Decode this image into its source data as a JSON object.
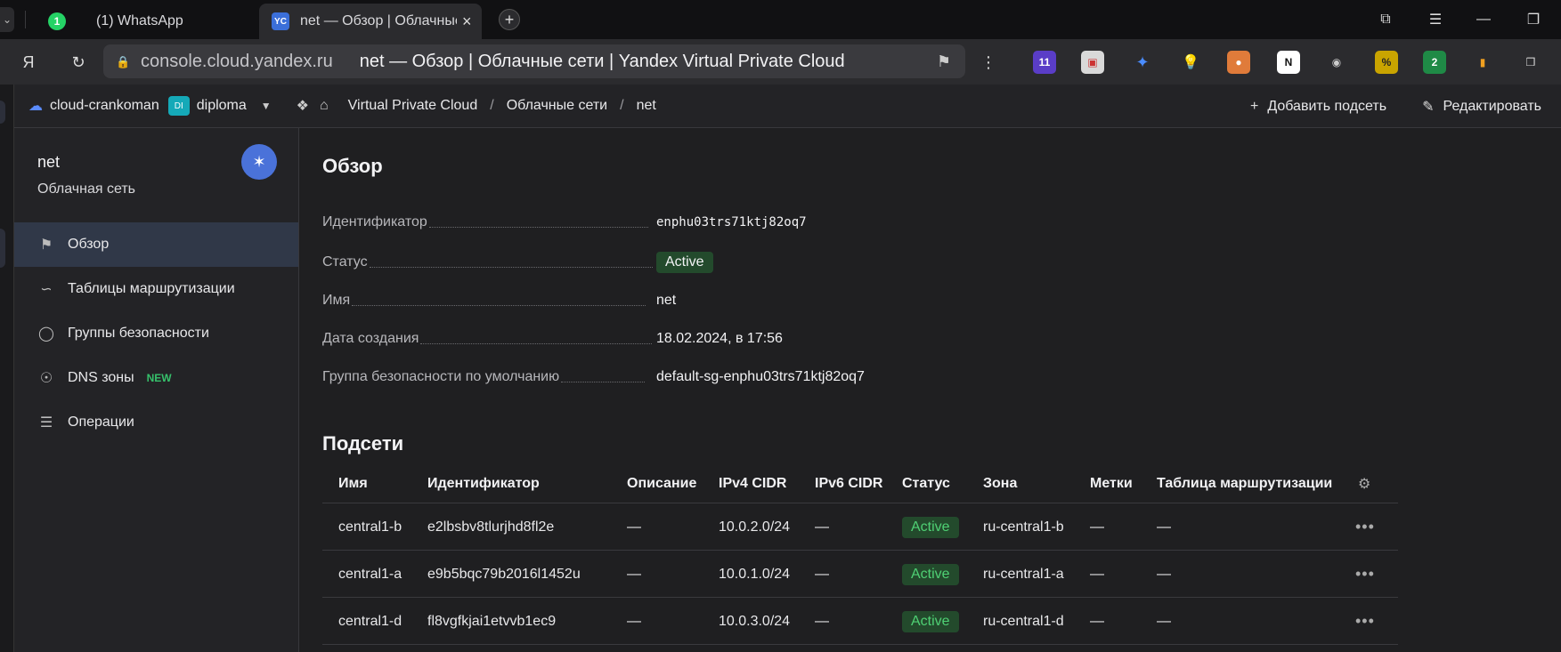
{
  "browser": {
    "tabs": [
      {
        "title": "(1) WhatsApp",
        "badge": "1"
      },
      {
        "title": "net — Обзор | Облачные",
        "icon_text": "YC"
      }
    ],
    "url": "console.cloud.yandex.ru",
    "page_title": "net — Обзор | Облачные сети | Yandex Virtual Private Cloud",
    "extension_badges": [
      "11",
      "2"
    ]
  },
  "header": {
    "cloud": "cloud-crankoman",
    "folder_badge": "DI",
    "folder": "diploma",
    "breadcrumbs": [
      "Virtual Private Cloud",
      "Облачные сети",
      "net"
    ],
    "separator": "/",
    "actions": {
      "add_subnet": "Добавить подсеть",
      "edit": "Редактировать"
    }
  },
  "sidebar": {
    "title": "net",
    "subtitle": "Облачная сеть",
    "items": [
      {
        "label": "Обзор",
        "icon": "flag-icon"
      },
      {
        "label": "Таблицы маршрутизации",
        "icon": "route-icon"
      },
      {
        "label": "Группы безопасности",
        "icon": "shield-icon"
      },
      {
        "label": "DNS зоны",
        "icon": "compass-icon",
        "badge": "NEW"
      },
      {
        "label": "Операции",
        "icon": "list-icon"
      }
    ]
  },
  "overview": {
    "heading": "Обзор",
    "props": [
      {
        "key": "Идентификатор",
        "value": "enphu03trs71ktj82oq7"
      },
      {
        "key": "Статус",
        "value": "Active"
      },
      {
        "key": "Имя",
        "value": "net"
      },
      {
        "key": "Дата создания",
        "value": "18.02.2024, в 17:56"
      },
      {
        "key": "Группа безопасности по умолчанию",
        "value": "default-sg-enphu03trs71ktj82oq7"
      }
    ]
  },
  "subnets": {
    "heading": "Подсети",
    "columns": [
      "Имя",
      "Идентификатор",
      "Описание",
      "IPv4 CIDR",
      "IPv6 CIDR",
      "Статус",
      "Зона",
      "Метки",
      "Таблица маршрутизации"
    ],
    "rows": [
      {
        "name": "central1-b",
        "id": "e2lbsbv8tlurjhd8fl2e",
        "desc": "—",
        "ipv4": "10.0.2.0/24",
        "ipv6": "—",
        "status": "Active",
        "zone": "ru-central1-b",
        "labels": "—",
        "route": "—"
      },
      {
        "name": "central1-a",
        "id": "e9b5bqc79b2016l1452u",
        "desc": "—",
        "ipv4": "10.0.1.0/24",
        "ipv6": "—",
        "status": "Active",
        "zone": "ru-central1-a",
        "labels": "—",
        "route": "—"
      },
      {
        "name": "central1-d",
        "id": "fl8vgfkjai1etvvb1ec9",
        "desc": "—",
        "ipv4": "10.0.3.0/24",
        "ipv6": "—",
        "status": "Active",
        "zone": "ru-central1-d",
        "labels": "—",
        "route": "—"
      }
    ]
  }
}
